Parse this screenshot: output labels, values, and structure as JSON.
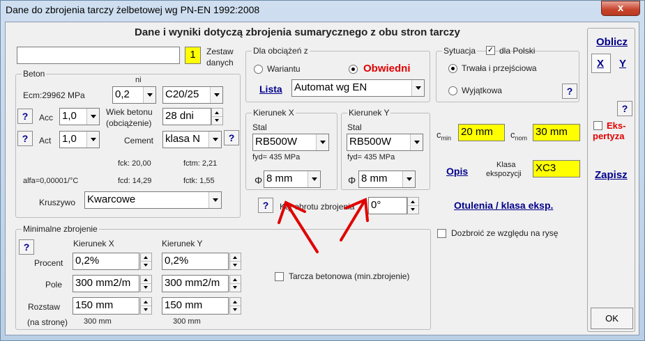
{
  "window": {
    "title": "Dane do zbrojenia tarczy żelbetowej  wg PN-EN 1992:2008",
    "close_label": "x"
  },
  "header": "Dane i wyniki dotyczą zbrojenia sumarycznego z obu stron tarczy",
  "zestaw": {
    "name_value": "",
    "number": "1",
    "label_line1": "Zestaw",
    "label_line2": "danych"
  },
  "beton": {
    "group_label": "Beton",
    "ni_label": "ni",
    "ecm_label": "Ecm:29962 MPa",
    "ni_value": "0,2",
    "class_value": "C20/25",
    "acc_label": "Acc",
    "acc_value": "1,0",
    "wiek_label_line1": "Wiek betonu",
    "wiek_label_line2": "(obciążenie)",
    "wiek_value": "28 dni",
    "act_label": "Act",
    "act_value": "1,0",
    "cement_label": "Cement",
    "cement_value": "klasa N",
    "fck": "fck: 20,00",
    "fctm": "fctm: 2,21",
    "alfa": "alfa=0,00001/°C",
    "fcd": "fcd: 14,29",
    "fctk": "fctk: 1,55",
    "kruszywo_label": "Kruszywo",
    "kruszywo_value": "Kwarcowe"
  },
  "obciazenia": {
    "group_label": "Dla obciążeń z",
    "wariantu_label": "Wariantu",
    "obwiedni_label": "Obwiedni",
    "lista_label": "Lista",
    "lista_value": "Automat wg EN"
  },
  "kierunek_x": {
    "group_label": "Kierunek X",
    "stal_label": "Stal",
    "stal_value": "RB500W",
    "fyd": "fyd= 435 MPa",
    "phi_symbol": "Φ",
    "phi_value": "8 mm"
  },
  "kierunek_y": {
    "group_label": "Kierunek Y",
    "stal_label": "Stal",
    "stal_value": "RB500W",
    "fyd": "fyd= 435 MPa",
    "phi_symbol": "Φ",
    "phi_value": "8 mm"
  },
  "obrot": {
    "label": "Kąt obrotu zbrojenia",
    "value": "0°"
  },
  "sytuacja": {
    "group_label": "Sytuacja",
    "dla_polski_label": "dla Polski",
    "trwala_label": "Trwała i przejściowa",
    "wyjatkowa_label": "Wyjątkowa"
  },
  "otulina": {
    "cmin_label": "c",
    "cmin_sub": "min",
    "cmin_value": "20 mm",
    "cnom_label": "c",
    "cnom_sub": "nom",
    "cnom_value": "30 mm",
    "opis_label": "Opis",
    "klasa_label_line1": "Klasa",
    "klasa_label_line2": "ekspozycji",
    "klasa_value": "XC3",
    "otulenia_link": "Otulenia / klasa eksp.",
    "dozbroic_label": "Dozbroić ze względu na rysę"
  },
  "minimalne": {
    "group_label": "Minimalne zbrojenie",
    "kierunek_x_label": "Kierunek X",
    "kierunek_y_label": "Kierunek Y",
    "procent_label": "Procent",
    "procent_x": "0,2%",
    "procent_y": "0,2%",
    "pole_label": "Pole",
    "pole_x": "300 mm2/m",
    "pole_y": "300 mm2/m",
    "rozstaw_label": "Rozstaw",
    "rozstaw_x": "150 mm",
    "rozstaw_y": "150 mm",
    "na_strone_label": "(na stronę)",
    "na_strone_x": "300 mm",
    "na_strone_y": "300 mm"
  },
  "tarcza_betonowa_label": "Tarcza betonowa (min.zbrojenie)",
  "right_panel": {
    "oblicz": "Oblicz",
    "x_label": "X",
    "y_label": "Y",
    "ekspertyza_line1": "Eks-",
    "ekspertyza_line2": "pertyza",
    "zapisz": "Zapisz",
    "ok": "OK"
  },
  "help_label": "?",
  "colors": {
    "highlight_yellow": "#ffff00",
    "link_blue": "#00008b",
    "obwiedni_red": "#e00000",
    "arrow_red": "#e00000"
  }
}
